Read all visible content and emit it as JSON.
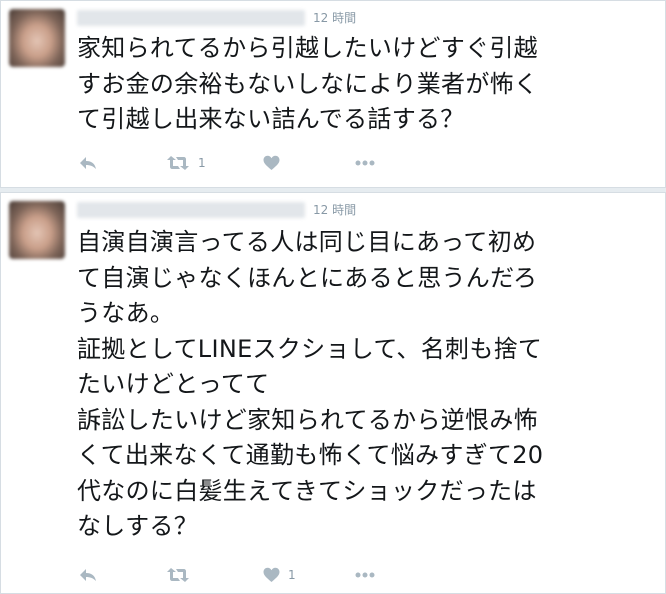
{
  "tweets": [
    {
      "timestamp": "12 時間",
      "text": "家知られてるから引越したいけどすぐ引越\nすお金の余裕もないしなにより業者が怖く\nて引越し出来ない詰んでる話する？",
      "retweet_count": "1",
      "like_count": ""
    },
    {
      "timestamp": "12 時間",
      "text": "自演自演言ってる人は同じ目にあって初め\nて自演じゃなくほんとにあると思うんだろ\nうなあ。\n証拠としてLINEスクショして、名刺も捨て\nたいけどとってて\n訴訟したいけど家知られてるから逆恨み怖\nくて出来なくて通勤も怖くて悩みすぎて20\n代なのに白髪生えてきてショックだったは\nなしする？",
      "retweet_count": "",
      "like_count": "1"
    }
  ],
  "icons": {
    "reply": "reply-icon",
    "retweet": "retweet-icon",
    "like": "heart-icon",
    "more": "more-icon"
  },
  "colors": {
    "icon": "#aab8c2",
    "meta": "#8899a6",
    "text": "#14171a"
  }
}
